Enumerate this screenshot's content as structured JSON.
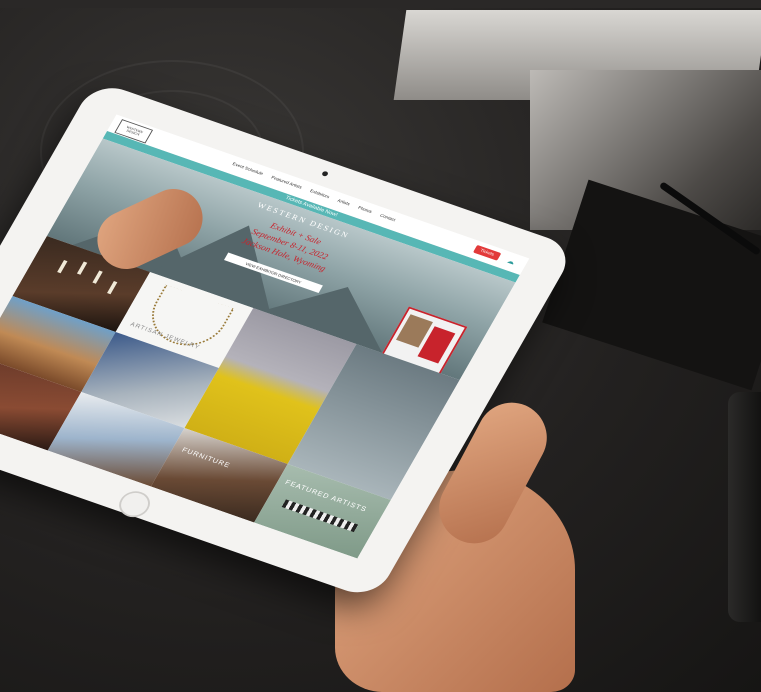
{
  "site": {
    "logo_lines": [
      "WESTERN",
      "DESIGN"
    ],
    "nav": [
      "Event Schedule",
      "Featured Artists",
      "Exhibitors",
      "Artists",
      "Photos",
      "Contact"
    ],
    "tickets_label": "Tickets",
    "banner": "Tickets Available Now!",
    "hero": {
      "title": "WESTERN DESIGN",
      "line1": "Exhibit + Sale",
      "line2": "September 8-11, 2022",
      "line3": "Jackson Hole, Wyoming",
      "cta": "VIEW EXHIBITOR DIRECTORY"
    },
    "tiles": {
      "jewelry": "ARTISAN JEWELRY",
      "hat": "",
      "leather": "",
      "interior": "",
      "chair": "FURNITURE",
      "featured": "FEATURED ARTISTS"
    }
  },
  "colors": {
    "accent": "#57b7b5",
    "brand_red": "#c8232c",
    "cta_red": "#e23a3a"
  }
}
